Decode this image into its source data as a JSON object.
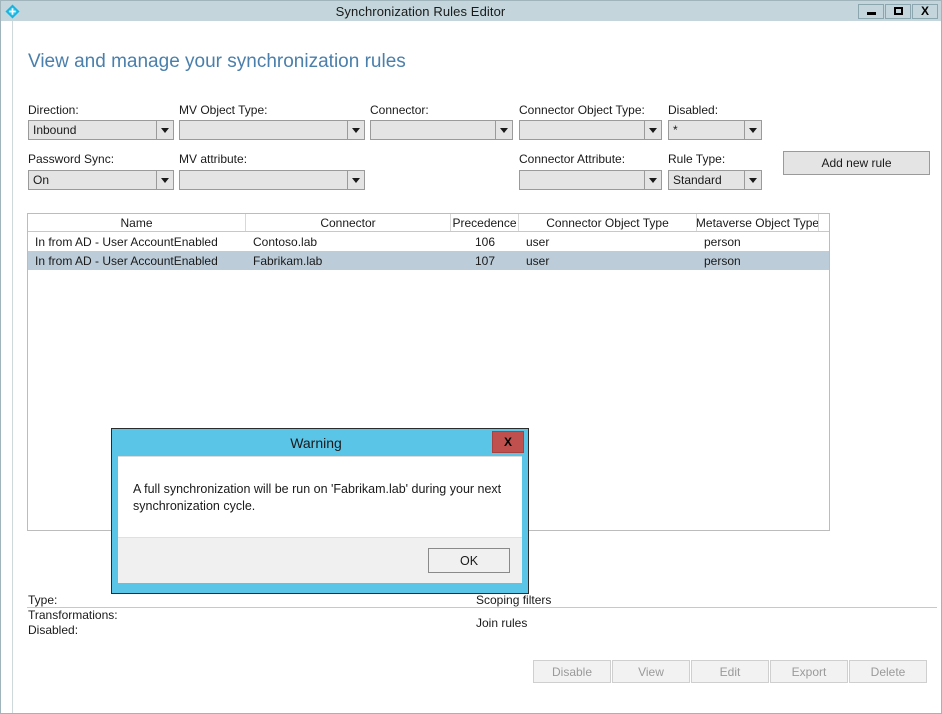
{
  "window": {
    "title": "Synchronization Rules Editor",
    "icon": "azure-ad-connect-diamond-icon",
    "minimize_label": "–",
    "maximize_label": "□",
    "close_label": "X"
  },
  "page": {
    "heading": "View and manage your synchronization rules"
  },
  "filters": {
    "direction": {
      "label": "Direction:",
      "value": "Inbound"
    },
    "mv_object_type": {
      "label": "MV Object Type:",
      "value": ""
    },
    "connector": {
      "label": "Connector:",
      "value": ""
    },
    "connector_object_type": {
      "label": "Connector Object Type:",
      "value": ""
    },
    "disabled": {
      "label": "Disabled:",
      "value": "*"
    },
    "password_sync": {
      "label": "Password Sync:",
      "value": "On"
    },
    "mv_attribute": {
      "label": "MV attribute:",
      "value": ""
    },
    "connector_attribute": {
      "label": "Connector Attribute:",
      "value": ""
    },
    "rule_type": {
      "label": "Rule Type:",
      "value": "Standard"
    }
  },
  "toolbar": {
    "add_new_rule": "Add new rule"
  },
  "table": {
    "columns": [
      "Name",
      "Connector",
      "Precedence",
      "Connector Object Type",
      "Metaverse Object Type"
    ],
    "rows": [
      {
        "name": "In from AD - User AccountEnabled",
        "connector": "Contoso.lab",
        "precedence": "106",
        "connector_object_type": "user",
        "metaverse_object_type": "person",
        "selected": false
      },
      {
        "name": "In from AD - User AccountEnabled",
        "connector": "Fabrikam.lab",
        "precedence": "107",
        "connector_object_type": "user",
        "metaverse_object_type": "person",
        "selected": true
      }
    ]
  },
  "details": {
    "type_label": "Type:",
    "transformations_label": "Transformations:",
    "disabled_label": "Disabled:",
    "scoping_filters_label": "Scoping filters",
    "join_rules_label": "Join rules"
  },
  "actions": [
    {
      "label": "Disable"
    },
    {
      "label": "View"
    },
    {
      "label": "Edit"
    },
    {
      "label": "Export"
    },
    {
      "label": "Delete"
    }
  ],
  "dialog": {
    "title": "Warning",
    "close_label": "X",
    "message": "A full synchronization will be run on 'Fabrikam.lab' during your next synchronization cycle.",
    "ok_label": "OK"
  },
  "colors": {
    "titlebar": "#c4d6db",
    "heading": "#4a7fab",
    "dialog_accent": "#5bc5e8",
    "dialog_close": "#c0504d",
    "row_selected": "#bcccd9",
    "control_fill": "#e4e4e4"
  }
}
